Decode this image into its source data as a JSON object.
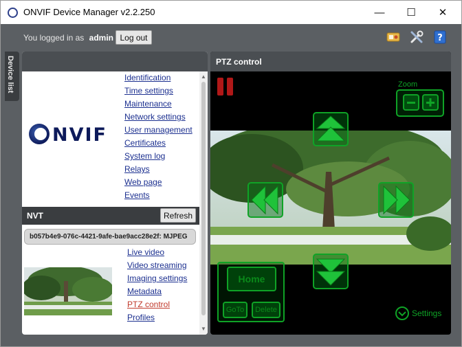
{
  "window": {
    "title": "ONVIF Device Manager v2.2.250",
    "minimize_glyph": "—",
    "maximize_glyph": "☐",
    "close_glyph": "✕"
  },
  "topbar": {
    "logged_in_text": "You logged in as",
    "username": "admin",
    "logout_label": "Log out",
    "tools": [
      "plugin-icon",
      "tools-icon",
      "help-icon"
    ]
  },
  "sidebar": {
    "device_list_tab": "Device list"
  },
  "device": {
    "logo_text": "ONVIF",
    "links": [
      {
        "label": "Identification"
      },
      {
        "label": "Time settings"
      },
      {
        "label": "Maintenance"
      },
      {
        "label": "Network settings"
      },
      {
        "label": "User management"
      },
      {
        "label": "Certificates"
      },
      {
        "label": "System log"
      },
      {
        "label": "Relays"
      },
      {
        "label": "Web page"
      },
      {
        "label": "Events"
      }
    ]
  },
  "nvt": {
    "label": "NVT",
    "refresh_label": "Refresh",
    "profile_id": "b057b4e9-076c-4421-9afe-bae9acc28e2f: MJPEG",
    "links": [
      {
        "label": "Live video",
        "active": false
      },
      {
        "label": "Video streaming",
        "active": false
      },
      {
        "label": "Imaging settings",
        "active": false
      },
      {
        "label": "Metadata",
        "active": false
      },
      {
        "label": "PTZ control",
        "active": true
      },
      {
        "label": "Profiles",
        "active": false
      }
    ]
  },
  "ptz": {
    "title": "PTZ control",
    "zoom_label": "Zoom",
    "home_label": "Home",
    "goto_label": "GoTo",
    "delete_label": "Delete",
    "settings_label": "Settings",
    "accent_color": "#0fa326",
    "pause_color": "#b01818"
  }
}
